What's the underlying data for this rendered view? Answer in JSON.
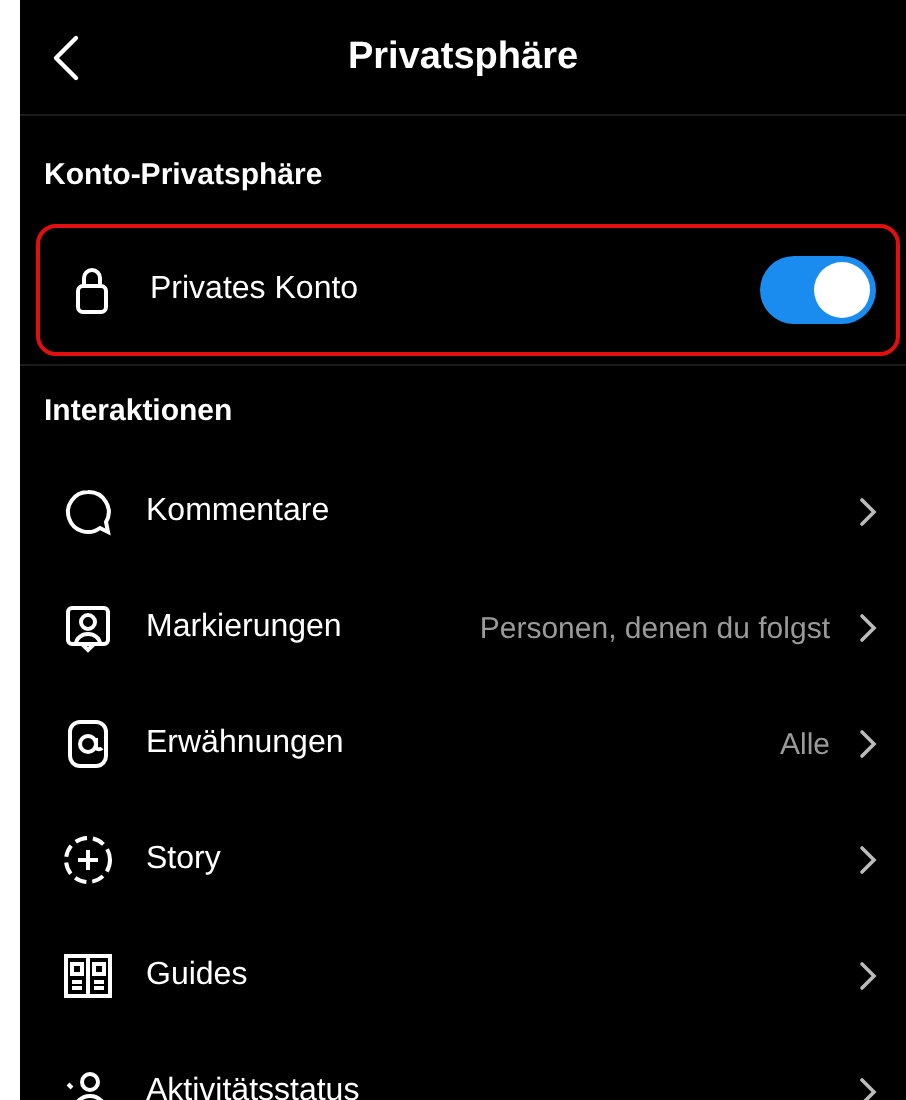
{
  "header": {
    "title": "Privatsphäre"
  },
  "sections": [
    {
      "title": "Konto-Privatsphäre",
      "items": [
        {
          "kind": "toggle",
          "label": "Privates Konto",
          "on": true,
          "highlighted": true
        }
      ]
    },
    {
      "title": "Interaktionen",
      "items": [
        {
          "kind": "link",
          "label": "Kommentare"
        },
        {
          "kind": "link",
          "label": "Markierungen",
          "value": "Personen, denen du folgst"
        },
        {
          "kind": "link",
          "label": "Erwähnungen",
          "value": "Alle"
        },
        {
          "kind": "link",
          "label": "Story"
        },
        {
          "kind": "link",
          "label": "Guides"
        },
        {
          "kind": "link",
          "label": "Aktivitätsstatus"
        }
      ]
    }
  ]
}
